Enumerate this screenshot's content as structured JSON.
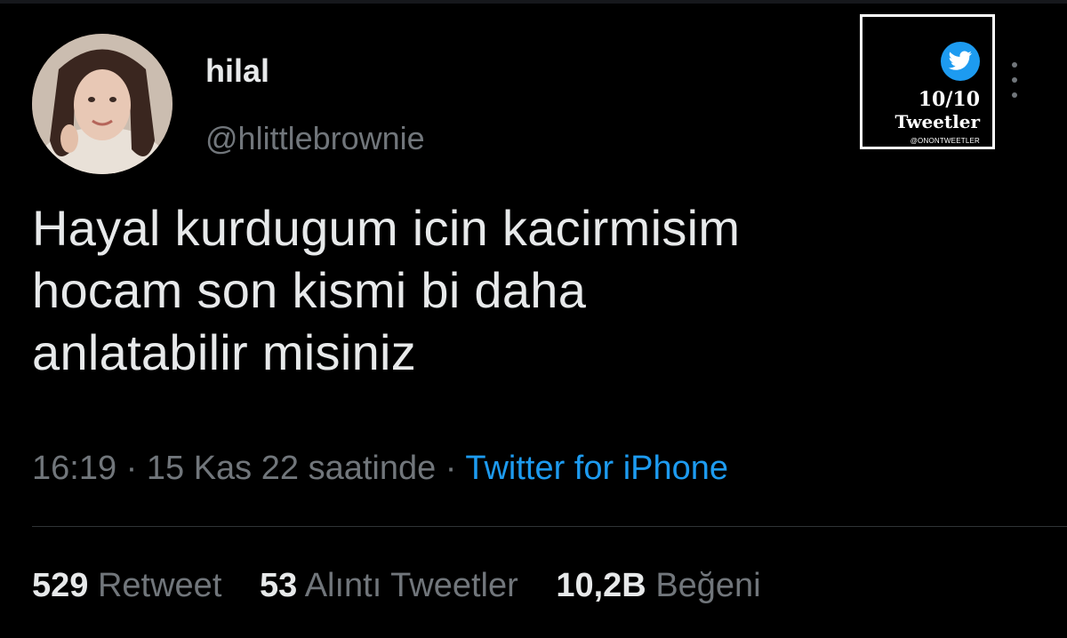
{
  "author": {
    "display_name": "hilal",
    "handle": "@hlittlebrownie"
  },
  "tweet": {
    "lines": [
      "Hayal kurdugum icin kacirmisim",
      "hocam son kismi bi daha",
      "anlatabilir misiniz"
    ]
  },
  "meta": {
    "time": "16:19",
    "separator": "·",
    "date": "15 Kas 22 saatinde",
    "source": "Twitter for iPhone"
  },
  "stats": [
    {
      "count": "529",
      "label": "Retweet"
    },
    {
      "count": "53",
      "label": "Alıntı Tweetler"
    },
    {
      "count": "10,2B",
      "label": "Beğeni"
    }
  ],
  "watermark": {
    "score": "10/10",
    "label": "Tweetler",
    "account": "@ONONTWEETLER",
    "icon": "twitter-bird-icon"
  },
  "colors": {
    "background": "#000000",
    "text": "#e7e9ea",
    "secondary": "#71767b",
    "accent": "#1d9bf0"
  }
}
